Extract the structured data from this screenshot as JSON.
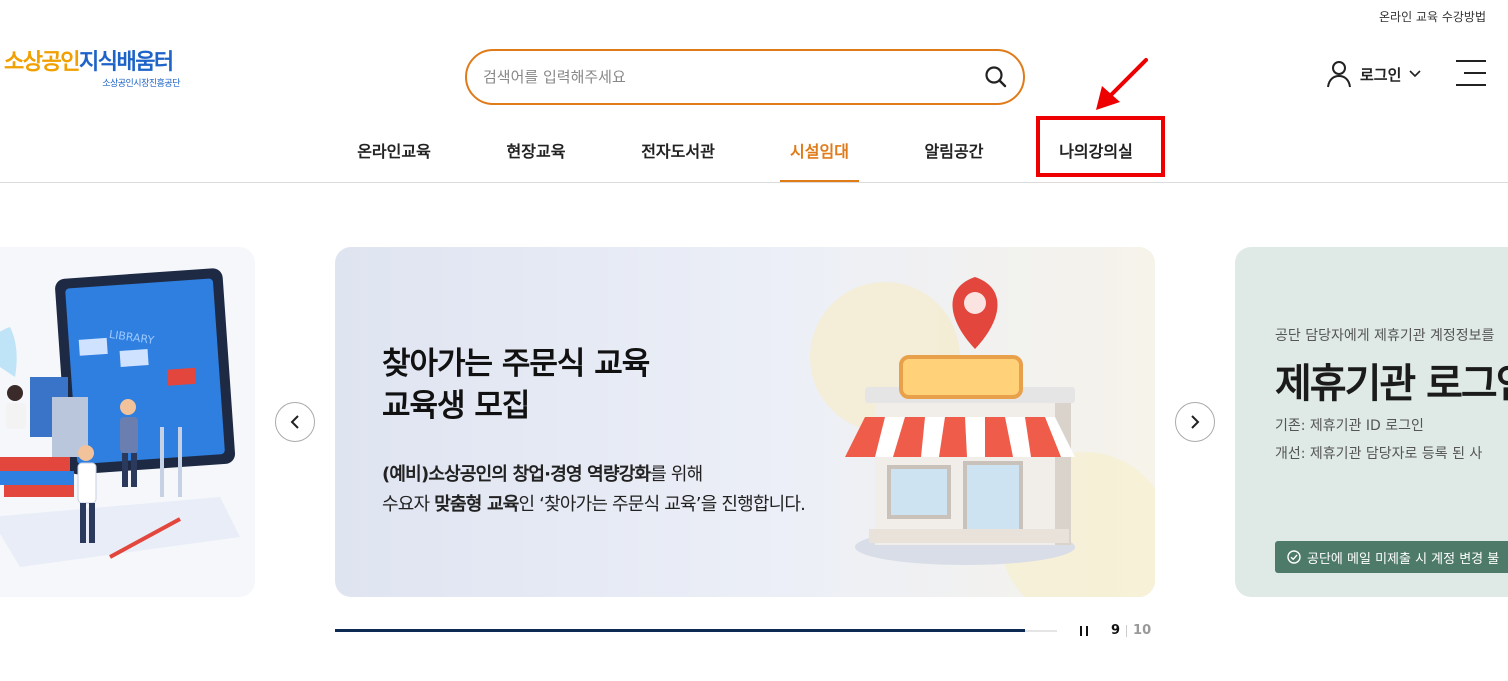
{
  "util": {
    "guide_link": "온라인 교육 수강방법"
  },
  "logo": {
    "part1": "소상공인",
    "part2": "지식배움터",
    "sub": "소상공인시장진흥공단"
  },
  "search": {
    "placeholder": "검색어를 입력해주세요"
  },
  "account": {
    "login_label": "로그인"
  },
  "nav": {
    "items": [
      {
        "label": "온라인교육"
      },
      {
        "label": "현장교육"
      },
      {
        "label": "전자도서관"
      },
      {
        "label": "시설임대",
        "active": true
      },
      {
        "label": "알림공간"
      },
      {
        "label": "나의강의실",
        "highlighted": true
      }
    ]
  },
  "carousel": {
    "left_slide": {
      "illustration_text": "LIBRARY"
    },
    "main_slide": {
      "title_line1": "찾아가는 주문식 교육",
      "title_line2": "교육생 모집",
      "desc_line1_bold": "(예비)소상공인의 창업·경영 역량강화",
      "desc_line1_rest": "를 위해",
      "desc_line2_a": "수요자 ",
      "desc_line2_bold": "맞춤형 교육",
      "desc_line2_b": "인 ‘찾아가는 주문식 교육’을 진행합니다."
    },
    "right_slide": {
      "subtitle": "공단 담당자에게 제휴기관 계정정보를",
      "title": "제휴기관 로그인",
      "line1": "기존: 제휴기관 ID 로그인",
      "line2": "개선: 제휴기관 담당자로 등록 된 사",
      "badge": "공단에 메일 미제출 시 계정 변경 불"
    },
    "progress": 0.955,
    "current": "9",
    "total": "10"
  },
  "colors": {
    "accent": "#e07b1a",
    "highlight": "#ee0000",
    "progress": "#0d2a52"
  }
}
